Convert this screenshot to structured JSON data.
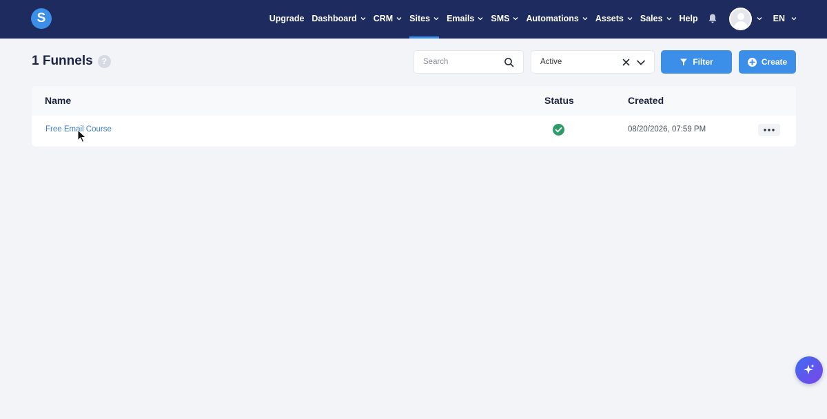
{
  "nav": {
    "logo_letter": "S",
    "items": [
      {
        "label": "Upgrade",
        "chevron": false,
        "active": false
      },
      {
        "label": "Dashboard",
        "chevron": true,
        "active": false
      },
      {
        "label": "CRM",
        "chevron": true,
        "active": false
      },
      {
        "label": "Sites",
        "chevron": true,
        "active": true
      },
      {
        "label": "Emails",
        "chevron": true,
        "active": false
      },
      {
        "label": "SMS",
        "chevron": true,
        "active": false
      },
      {
        "label": "Automations",
        "chevron": true,
        "active": false
      },
      {
        "label": "Assets",
        "chevron": true,
        "active": false
      },
      {
        "label": "Sales",
        "chevron": true,
        "active": false
      },
      {
        "label": "Help",
        "chevron": false,
        "active": false
      }
    ],
    "language": "EN"
  },
  "header": {
    "title": "1 Funnels",
    "help_icon": "?"
  },
  "search": {
    "placeholder": "Search",
    "value": ""
  },
  "status_filter": {
    "selected": "Active"
  },
  "buttons": {
    "filter": "Filter",
    "create": "Create"
  },
  "table": {
    "columns": [
      "Name",
      "Status",
      "Created"
    ],
    "rows": [
      {
        "name": "Free Email Course",
        "status": "active",
        "created": "08/20/2026, 07:59 PM"
      }
    ]
  },
  "colors": {
    "nav_bg": "#1d2b5e",
    "accent": "#3b8fe8",
    "status_ok": "#2e9b6a",
    "link": "#3b7fd0"
  },
  "icons": [
    "logo-icon",
    "chevron-down-icon",
    "bell-icon",
    "avatar-icon",
    "question-icon",
    "search-icon",
    "close-icon",
    "filter-icon",
    "plus-circle-icon",
    "check-circle-icon",
    "more-horizontal-icon",
    "sparkle-icon"
  ]
}
